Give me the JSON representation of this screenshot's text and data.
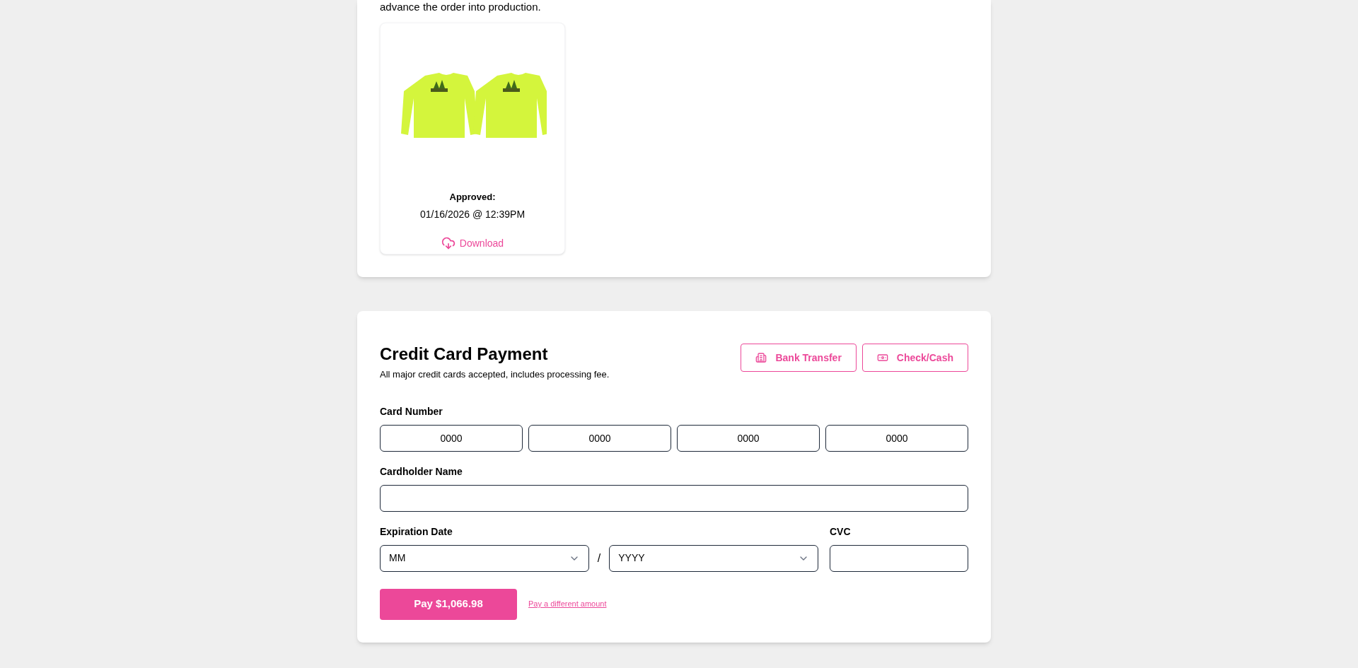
{
  "intro_text": "advance the order into production.",
  "proofs": [
    {
      "kind": "picture",
      "label": "Approved:",
      "date": "01/16/2026 @ 12:39PM",
      "download": "Download"
    }
  ],
  "payment": {
    "title": "Credit Card Payment",
    "subtitle": "All major credit cards accepted, includes processing fee.",
    "methods": [
      {
        "kind": "bank",
        "label": "Bank Transfer"
      },
      {
        "kind": "cash",
        "label": "Check/Cash"
      }
    ],
    "card_number": {
      "label": "Card Number",
      "placeholders": [
        "0000",
        "0000",
        "0000",
        "0000"
      ]
    },
    "cardholder": {
      "label": "Cardholder Name"
    },
    "expiration": {
      "label": "Expiration Date",
      "month": "MM",
      "separator": "/",
      "year": "YYYY"
    },
    "cvc": {
      "label": "CVC"
    },
    "pay_button": "Pay $1,066.98",
    "alt_link": "Pay a different amount"
  }
}
